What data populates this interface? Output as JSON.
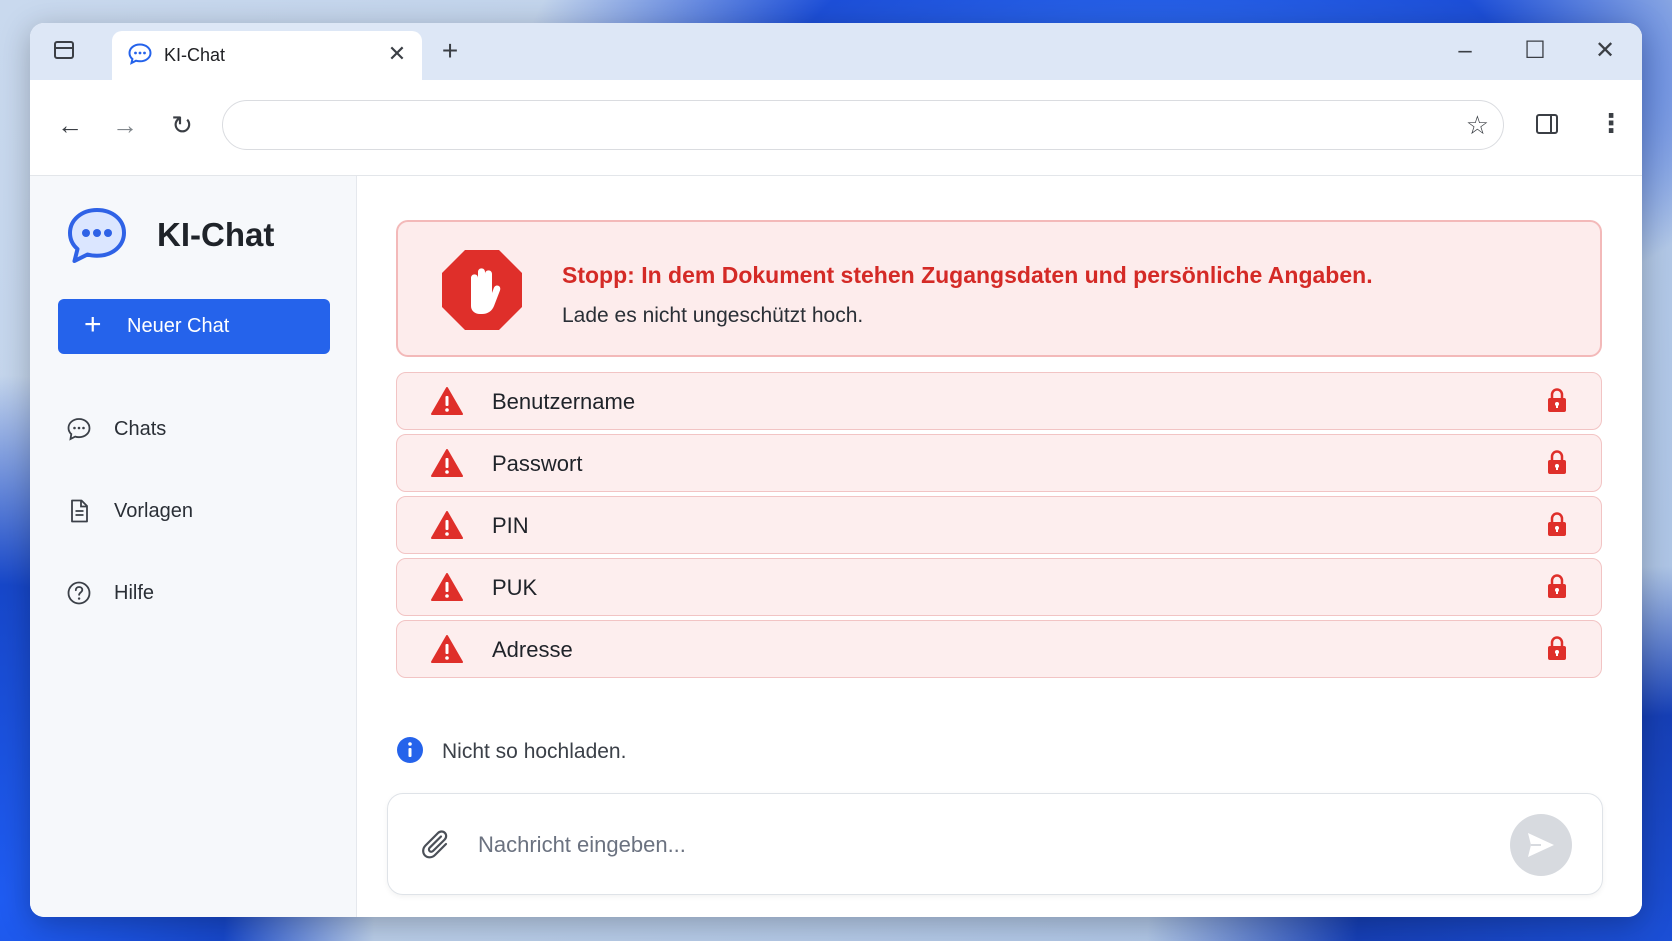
{
  "browser": {
    "tab_title": "KI-Chat",
    "tab_close": "✕",
    "new_tab": "+",
    "window_min": "–",
    "window_max": "☐",
    "window_close": "✕",
    "url": ""
  },
  "sidebar": {
    "brand": "KI-Chat",
    "new_chat_label": "Neuer Chat",
    "items": [
      {
        "label": "Chats",
        "icon": "chat-bubble-icon"
      },
      {
        "label": "Vorlagen",
        "icon": "document-icon"
      },
      {
        "label": "Hilfe",
        "icon": "help-circle-icon"
      }
    ]
  },
  "alert": {
    "title": "Stopp: In dem Dokument stehen Zugangsdaten und persönliche Angaben.",
    "text": "Lade es nicht ungeschützt hoch.",
    "icon": "stop-hand-icon"
  },
  "sensitive_items": [
    {
      "label": "Benutzername"
    },
    {
      "label": "Passwort"
    },
    {
      "label": "PIN"
    },
    {
      "label": "PUK"
    },
    {
      "label": "Adresse"
    }
  ],
  "hint": {
    "text": "Nicht so hochladen."
  },
  "composer": {
    "placeholder": "Nachricht eingeben...",
    "value": ""
  },
  "colors": {
    "accent": "#2563eb",
    "danger": "#d42a26",
    "alert_bg": "#fdecec"
  }
}
